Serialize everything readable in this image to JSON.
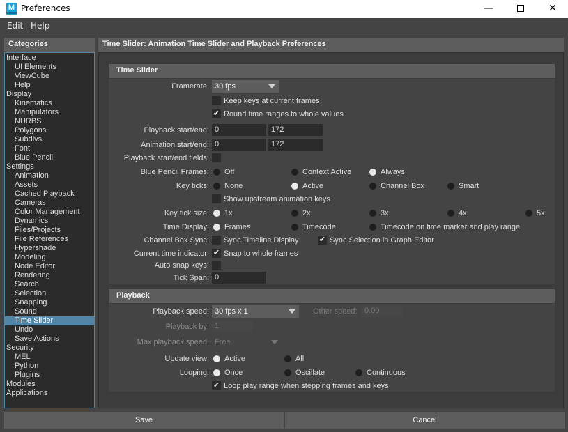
{
  "window": {
    "title": "Preferences",
    "icon_letter": "M",
    "controls": [
      "minimize-icon",
      "maximize-icon",
      "close-icon"
    ],
    "close_glyph": "✕",
    "min_glyph": "—"
  },
  "menu": {
    "items": [
      "Edit",
      "Help"
    ]
  },
  "categories": {
    "header": "Categories",
    "items": [
      {
        "label": "Interface",
        "level": 0
      },
      {
        "label": "UI Elements",
        "level": 1
      },
      {
        "label": "ViewCube",
        "level": 1
      },
      {
        "label": "Help",
        "level": 1
      },
      {
        "label": "Display",
        "level": 0
      },
      {
        "label": "Kinematics",
        "level": 1
      },
      {
        "label": "Manipulators",
        "level": 1
      },
      {
        "label": "NURBS",
        "level": 1
      },
      {
        "label": "Polygons",
        "level": 1
      },
      {
        "label": "Subdivs",
        "level": 1
      },
      {
        "label": "Font",
        "level": 1
      },
      {
        "label": "Blue Pencil",
        "level": 1
      },
      {
        "label": "Settings",
        "level": 0
      },
      {
        "label": "Animation",
        "level": 1
      },
      {
        "label": "Assets",
        "level": 1
      },
      {
        "label": "Cached Playback",
        "level": 1
      },
      {
        "label": "Cameras",
        "level": 1
      },
      {
        "label": "Color Management",
        "level": 1
      },
      {
        "label": "Dynamics",
        "level": 1
      },
      {
        "label": "Files/Projects",
        "level": 1
      },
      {
        "label": "File References",
        "level": 1
      },
      {
        "label": "Hypershade",
        "level": 1
      },
      {
        "label": "Modeling",
        "level": 1
      },
      {
        "label": "Node Editor",
        "level": 1
      },
      {
        "label": "Rendering",
        "level": 1
      },
      {
        "label": "Search",
        "level": 1
      },
      {
        "label": "Selection",
        "level": 1
      },
      {
        "label": "Snapping",
        "level": 1
      },
      {
        "label": "Sound",
        "level": 1
      },
      {
        "label": "Time Slider",
        "level": 1,
        "selected": true
      },
      {
        "label": "Undo",
        "level": 1
      },
      {
        "label": "Save Actions",
        "level": 1
      },
      {
        "label": "Security",
        "level": 0
      },
      {
        "label": "MEL",
        "level": 1
      },
      {
        "label": "Python",
        "level": 1
      },
      {
        "label": "Plugins",
        "level": 1
      },
      {
        "label": "Modules",
        "level": 0
      },
      {
        "label": "Applications",
        "level": 0
      }
    ]
  },
  "main": {
    "header": "Time Slider: Animation Time Slider and Playback Preferences",
    "time_slider": {
      "title": "Time Slider",
      "framerate_label": "Framerate:",
      "framerate_value": "30 fps",
      "keep_keys": {
        "label": "Keep keys at current frames",
        "checked": false
      },
      "round_ranges": {
        "label": "Round time ranges to whole values",
        "checked": true
      },
      "playback_label": "Playback start/end:",
      "playback_start": "0",
      "playback_end": "172",
      "animation_label": "Animation start/end:",
      "animation_start": "0",
      "animation_end": "172",
      "playback_fields_label": "Playback start/end fields:",
      "playback_fields_checked": false,
      "blue_pencil_label": "Blue Pencil Frames:",
      "blue_pencil_options": [
        "Off",
        "Context Active",
        "Always"
      ],
      "blue_pencil_selected": 2,
      "key_ticks_label": "Key ticks:",
      "key_ticks_options": [
        "None",
        "Active",
        "Channel Box",
        "Smart"
      ],
      "key_ticks_selected": 1,
      "show_upstream": {
        "label": "Show upstream animation keys",
        "checked": false
      },
      "tick_size_label": "Key tick size:",
      "tick_size_options": [
        "1x",
        "2x",
        "3x",
        "4x",
        "5x"
      ],
      "tick_size_selected": 0,
      "time_display_label": "Time Display:",
      "time_display_options": [
        "Frames",
        "Timecode",
        "Timecode on time marker and play range"
      ],
      "time_display_selected": 0,
      "channel_sync_label": "Channel Box Sync:",
      "sync_timeline": {
        "label": "Sync Timeline Display",
        "checked": false
      },
      "sync_selection": {
        "label": "Sync Selection in Graph Editor",
        "checked": true
      },
      "current_time_label": "Current time indicator:",
      "snap_whole": {
        "label": "Snap to whole frames",
        "checked": true
      },
      "auto_snap_label": "Auto snap keys:",
      "auto_snap_checked": false,
      "tick_span_label": "Tick Span:",
      "tick_span_value": "0",
      "check_glyph": "✔"
    },
    "playback": {
      "title": "Playback",
      "speed_label": "Playback speed:",
      "speed_value": "30 fps x 1",
      "other_speed_label": "Other speed:",
      "other_speed_value": "0.00",
      "playback_by_label": "Playback by:",
      "playback_by_value": "1",
      "max_speed_label": "Max playback speed:",
      "max_speed_value": "Free",
      "update_view_label": "Update view:",
      "update_view_options": [
        "Active",
        "All"
      ],
      "update_view_selected": 0,
      "looping_label": "Looping:",
      "looping_options": [
        "Once",
        "Oscillate",
        "Continuous"
      ],
      "looping_selected": 0,
      "loop_play": {
        "label": "Loop play range when stepping frames and keys",
        "checked": true
      }
    }
  },
  "buttons": {
    "save": "Save",
    "cancel": "Cancel"
  }
}
